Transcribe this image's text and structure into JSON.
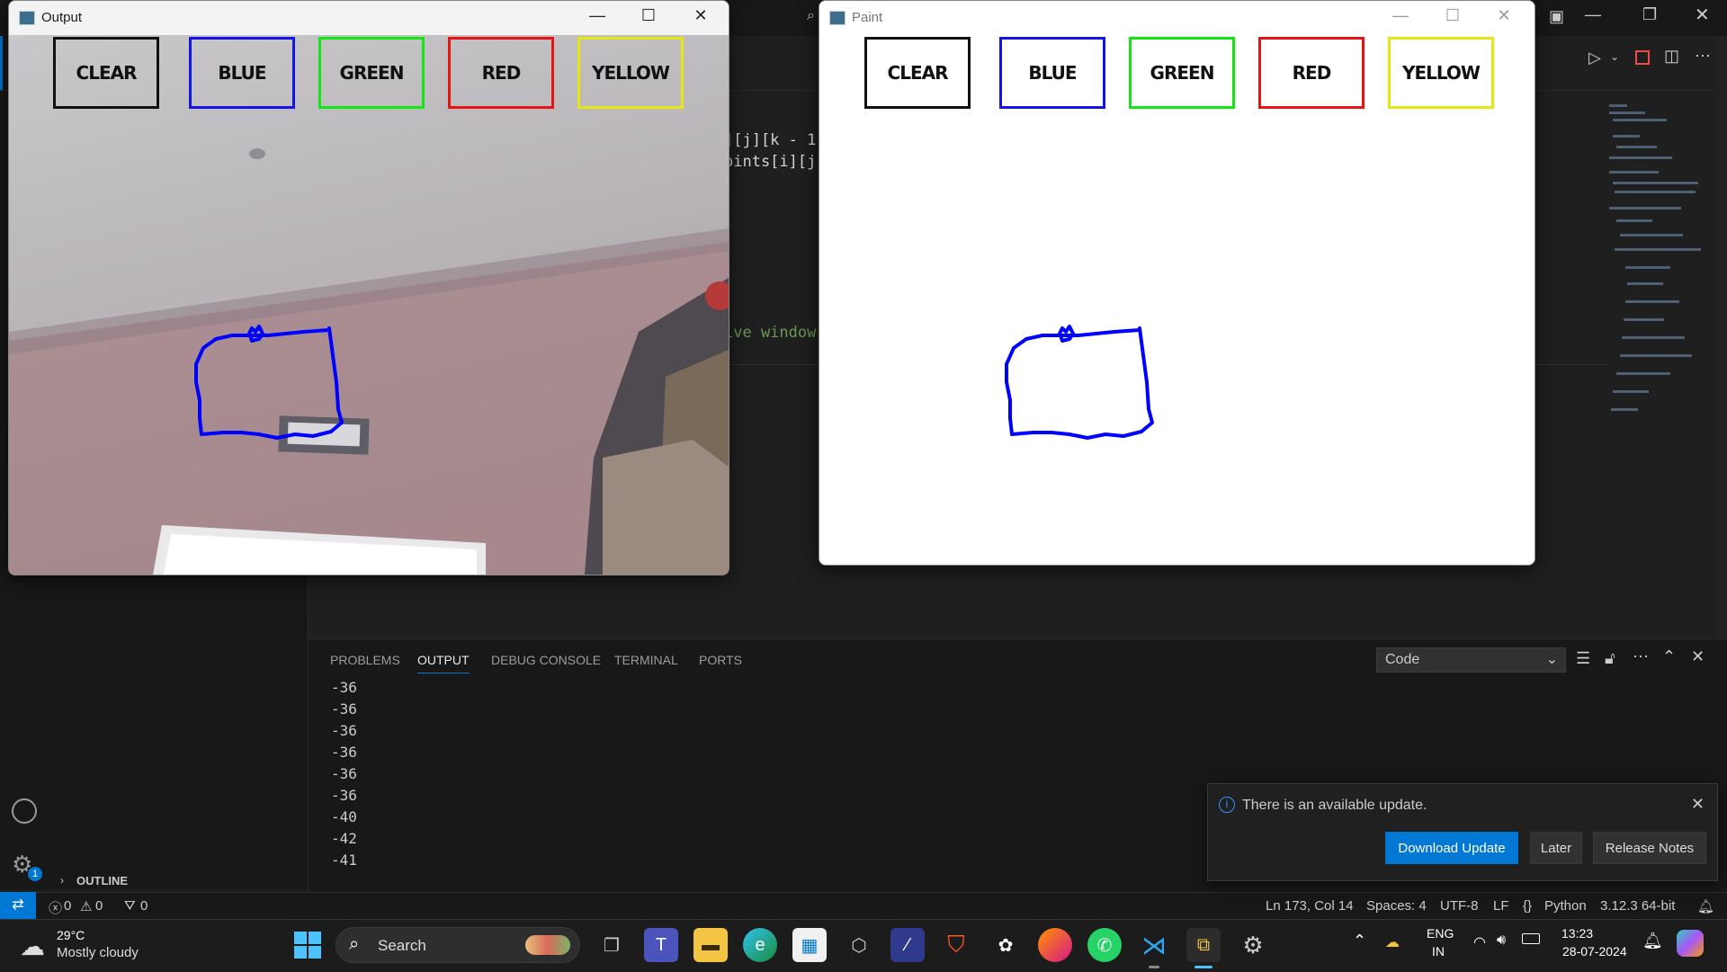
{
  "output_window": {
    "title": "Output",
    "buttons": [
      {
        "label": "CLEAR",
        "color": "#111111"
      },
      {
        "label": "BLUE",
        "color": "#1414e6"
      },
      {
        "label": "GREEN",
        "color": "#14e614"
      },
      {
        "label": "RED",
        "color": "#e61414"
      },
      {
        "label": "YELLOW",
        "color": "#e6e614"
      }
    ],
    "stroke_color": "#0000ff"
  },
  "paint_window": {
    "title": "Paint",
    "buttons": [
      {
        "label": "CLEAR",
        "color": "#111111"
      },
      {
        "label": "BLUE",
        "color": "#1414e6"
      },
      {
        "label": "GREEN",
        "color": "#14e614"
      },
      {
        "label": "RED",
        "color": "#e61414"
      },
      {
        "label": "YELLOW",
        "color": "#e6e614"
      }
    ],
    "stroke_color": "#0000ff"
  },
  "editor": {
    "code_fragments": [
      "][j][k - 1",
      "oints[i][j]",
      "ive window"
    ]
  },
  "panel": {
    "tabs": [
      "PROBLEMS",
      "OUTPUT",
      "DEBUG CONSOLE",
      "TERMINAL",
      "PORTS"
    ],
    "active_tab": "OUTPUT",
    "channel_select": "Code",
    "output_lines": [
      "-36",
      "-36",
      "-36",
      "-36",
      "-36",
      "-36",
      "-40",
      "-42",
      "-41"
    ]
  },
  "sidebar": {
    "outline_label": "OUTLINE",
    "accounts_badge": "1"
  },
  "notification": {
    "message": "There is an available update.",
    "primary_button": "Download Update",
    "secondary_button": "Later",
    "tertiary_button": "Release Notes"
  },
  "statusbar": {
    "errors": "0",
    "warnings": "0",
    "ports": "0",
    "position": "Ln 173, Col 14",
    "spaces": "Spaces: 4",
    "encoding": "UTF-8",
    "eol": "LF",
    "language": "Python",
    "interpreter": "3.12.3 64-bit"
  },
  "taskbar": {
    "weather_temp": "29°C",
    "weather_desc": "Mostly cloudy",
    "search_label": "Search",
    "lang_top": "ENG",
    "lang_bottom": "IN",
    "time": "13:23",
    "date": "28-07-2024"
  }
}
